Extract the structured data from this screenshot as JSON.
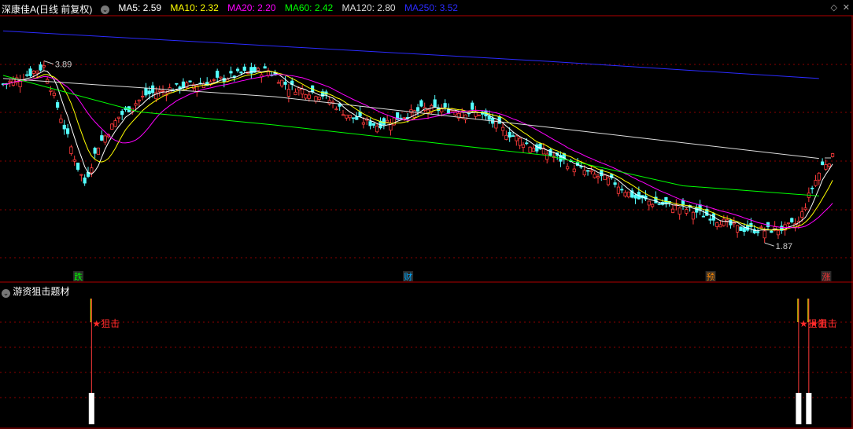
{
  "header": {
    "stock_label": "深康佳A",
    "period_label": "(日线 前复权)",
    "ma": [
      {
        "label": "MA5: 2.59",
        "color": "#ffffff"
      },
      {
        "label": "MA10: 2.32",
        "color": "#ffff00"
      },
      {
        "label": "MA20: 2.20",
        "color": "#ff00ff"
      },
      {
        "label": "MA60: 2.42",
        "color": "#00ff00"
      },
      {
        "label": "MA120: 2.80",
        "color": "#dddddd"
      },
      {
        "label": "MA250: 3.52",
        "color": "#2b2bff"
      }
    ]
  },
  "indicator": {
    "title": "游资狙击题材",
    "signal_label": "★狙击"
  },
  "markers": [
    {
      "text": "跌",
      "color": "#00ff00"
    },
    {
      "text": "财",
      "color": "#00aaff"
    },
    {
      "text": "预",
      "color": "#ff8800"
    },
    {
      "text": "涨",
      "color": "#ff3333"
    }
  ],
  "chart_data": {
    "type": "candlestick",
    "price_labels": {
      "high": "3.89",
      "low": "1.87"
    },
    "ma250": [
      [
        0,
        4.05
      ],
      [
        80,
        3.9
      ],
      [
        160,
        3.75
      ],
      [
        240,
        3.58
      ]
    ],
    "ma120": [
      [
        0,
        3.58
      ],
      [
        80,
        3.4
      ],
      [
        160,
        3.1
      ],
      [
        240,
        2.79
      ]
    ],
    "ma60": [
      [
        0,
        3.61
      ],
      [
        40,
        3.25
      ],
      [
        80,
        3.12
      ],
      [
        120,
        2.97
      ],
      [
        160,
        2.82
      ],
      [
        200,
        2.52
      ],
      [
        240,
        2.42
      ]
    ],
    "signals": [
      26,
      234,
      237
    ],
    "ohlc_seed": "procedural"
  },
  "colors": {
    "up": "#ff3b3b",
    "down": "#54ffff",
    "grid": "#8b0000",
    "divider": "#b00000",
    "ma5": "#ffffff",
    "ma10": "#ffff00",
    "ma20": "#ff00ff",
    "ma60": "#00ff00",
    "ma120": "#dddddd",
    "ma250": "#2b2bff"
  }
}
